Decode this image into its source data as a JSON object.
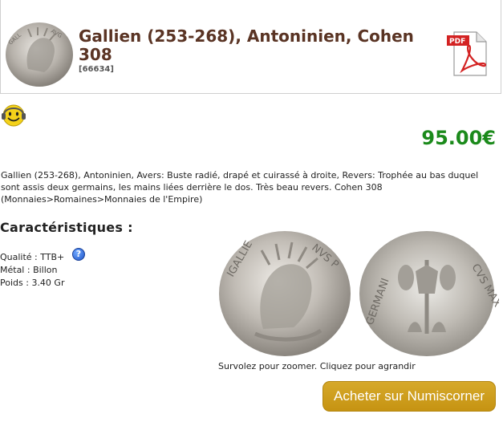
{
  "product": {
    "title": "Gallien (253-268), Antoninien, Cohen 308",
    "reference": "[66634]",
    "price": "95.00€",
    "description": "Gallien (253-268), Antoninien, Avers: Buste radié, drapé et cuirassé à droite, Revers: Trophée au bas duquel sont assis deux germains, les mains liées derrière le dos. Très beau revers. Cohen 308 (Monnaies>Romaines>Monnaies de l'Empire)"
  },
  "specs": {
    "heading": "Caractéristiques :",
    "quality": "Qualité : TTB+",
    "metal": "Métal : Billon",
    "weight": "Poids : 3.40 Gr",
    "help_symbol": "?"
  },
  "image": {
    "caption": "Survolez pour zoomer. Cliquez pour agrandir"
  },
  "pdf_icon": {
    "label": "PDF"
  },
  "buy_button": {
    "label": "Acheter sur Numiscorner"
  },
  "colors": {
    "title": "#5a3424",
    "price": "#1b8a1b",
    "button": "#cc9a18"
  }
}
